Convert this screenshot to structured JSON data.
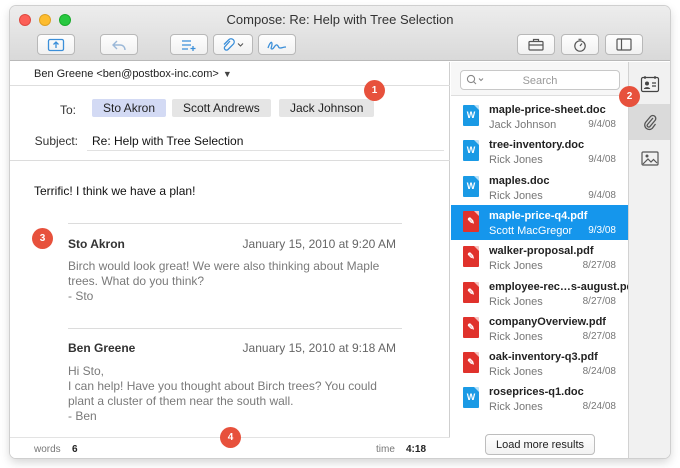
{
  "window": {
    "title": "Compose: Re: Help with Tree Selection"
  },
  "compose": {
    "from": "Ben Greene <ben@postbox-inc.com>",
    "to_label": "To:",
    "recipients": [
      "Sto Akron",
      "Scott Andrews",
      "Jack Johnson"
    ],
    "subject_label": "Subject:",
    "subject": "Re: Help with Tree Selection",
    "intro": "Terrific! I think we have a plan!",
    "quotes": [
      {
        "name": "Sto Akron",
        "date": "January 15, 2010 at 9:20 AM",
        "lines": [
          "Birch would look great!  We were also thinking about Maple",
          "trees.  What do you think?",
          "- Sto"
        ]
      },
      {
        "name": "Ben Greene",
        "date": "January 15, 2010 at 9:18 AM",
        "lines": [
          "Hi Sto,",
          "I can help!  Have you thought about Birch trees?  You could",
          "plant a cluster of them near the south wall.",
          "- Ben"
        ]
      }
    ],
    "status": {
      "words_label": "words",
      "words": "6",
      "time_label": "time",
      "time": "4:18"
    }
  },
  "search": {
    "placeholder": "Search",
    "files": [
      {
        "name": "maple-price-sheet.doc",
        "person": "Jack Johnson",
        "date": "9/4/08",
        "kind": "doc",
        "selected": false
      },
      {
        "name": "tree-inventory.doc",
        "person": "Rick Jones",
        "date": "9/4/08",
        "kind": "doc",
        "selected": false
      },
      {
        "name": "maples.doc",
        "person": "Rick Jones",
        "date": "9/4/08",
        "kind": "doc",
        "selected": false
      },
      {
        "name": "maple-price-q4.pdf",
        "person": "Scott MacGregor",
        "date": "9/3/08",
        "kind": "pdf",
        "selected": true
      },
      {
        "name": "walker-proposal.pdf",
        "person": "Rick Jones",
        "date": "8/27/08",
        "kind": "pdf",
        "selected": false
      },
      {
        "name": "employee-rec…s-august.pdf",
        "person": "Rick Jones",
        "date": "8/27/08",
        "kind": "pdf",
        "selected": false
      },
      {
        "name": "companyOverview.pdf",
        "person": "Rick Jones",
        "date": "8/27/08",
        "kind": "pdf",
        "selected": false
      },
      {
        "name": "oak-inventory-q3.pdf",
        "person": "Rick Jones",
        "date": "8/24/08",
        "kind": "pdf",
        "selected": false
      },
      {
        "name": "roseprices-q1.doc",
        "person": "Rick Jones",
        "date": "8/24/08",
        "kind": "doc",
        "selected": false
      }
    ],
    "load_more": "Load more results"
  },
  "icons": {
    "doc_glyph": "W",
    "pdf_glyph": "✎",
    "toolbar": [
      "send-icon",
      "reply-icon",
      "list-add-icon",
      "attach-icon",
      "signature-icon",
      "briefcase-icon",
      "timer-icon",
      "sidebar-toggle-icon"
    ],
    "sidebar": [
      "contacts-icon",
      "attachment-icon",
      "image-icon"
    ]
  },
  "callouts": [
    "1",
    "2",
    "3",
    "4"
  ],
  "colors": {
    "selection": "#1596ec",
    "chip_blue": "#d3daf4",
    "chip_gray": "#e5e5e5",
    "callout": "#e7513c",
    "doc_icon": "#1a9ae5",
    "pdf_icon": "#e0322c"
  }
}
